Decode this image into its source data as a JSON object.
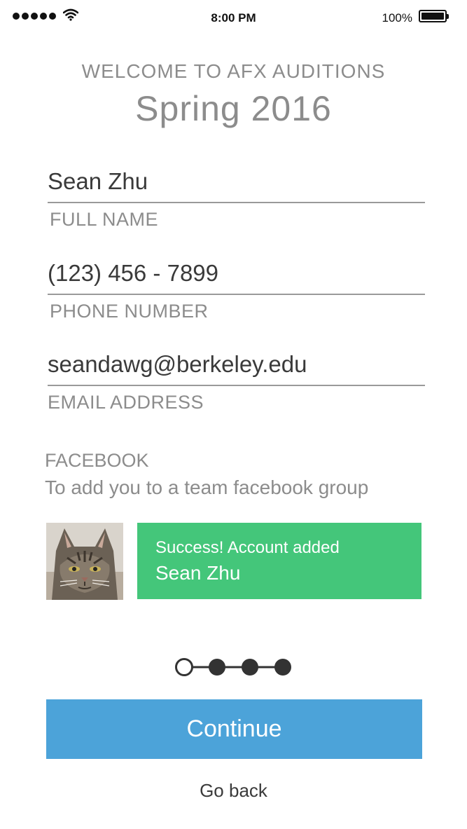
{
  "status_bar": {
    "time": "8:00 PM",
    "battery_percent": "100%",
    "signal_icon": "signal-dots-icon",
    "wifi_icon": "wifi-icon",
    "battery_icon": "battery-icon"
  },
  "header": {
    "welcome": "WELCOME TO AFX AUDITIONS",
    "season": "Spring 2016"
  },
  "form": {
    "name": {
      "value": "Sean Zhu",
      "label": "FULL NAME"
    },
    "phone": {
      "value": "(123) 456 - 7899",
      "label": "PHONE NUMBER"
    },
    "email": {
      "value": "seandawg@berkeley.edu",
      "label": "EMAIL ADDRESS"
    }
  },
  "facebook": {
    "title": "FACEBOOK",
    "subtitle": "To add you to a team facebook group",
    "success_message": "Success! Account added",
    "account_name": "Sean Zhu"
  },
  "progress": {
    "steps": 4,
    "current_step": 1
  },
  "actions": {
    "continue_label": "Continue",
    "back_label": "Go back"
  },
  "colors": {
    "success": "#44c67a",
    "primary": "#4ca3d9",
    "muted_text": "#8c8c8c",
    "body_text": "#3a3a3a"
  }
}
